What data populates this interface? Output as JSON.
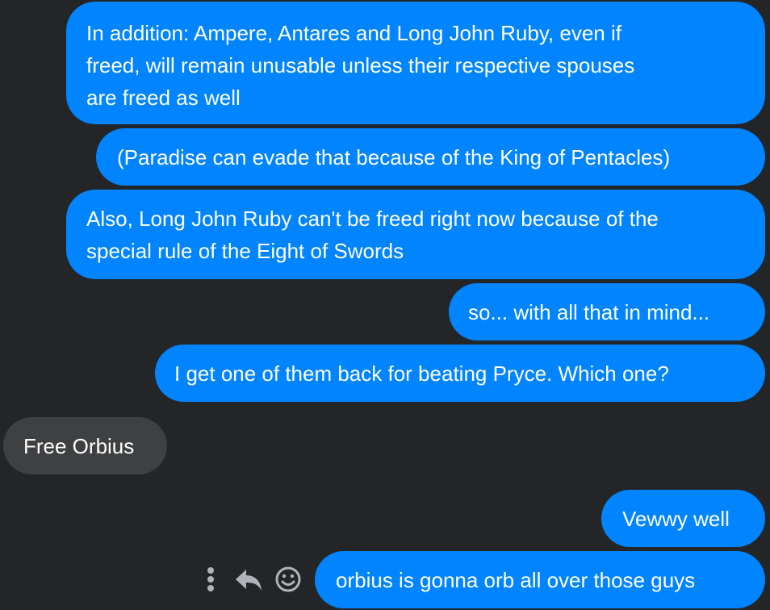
{
  "conversation": {
    "messages": [
      {
        "sender": "me",
        "text": "In addition: Ampere, Antares and Long John Ruby, even if\nfreed, will remain unusable unless their respective spouses\nare freed as well"
      },
      {
        "sender": "me",
        "text": "(Paradise can evade that because of the King of Pentacles)"
      },
      {
        "sender": "me",
        "text": "Also, Long John Ruby can't be freed right now because of the\nspecial rule of the Eight of Swords"
      },
      {
        "sender": "me",
        "text": "so... with all that in mind..."
      },
      {
        "sender": "me",
        "text": "I get one of them back for beating Pryce.  Which one?"
      },
      {
        "sender": "them",
        "text": "Free Orbius"
      },
      {
        "sender": "me",
        "text": "Vewwy well"
      },
      {
        "sender": "me",
        "text": "orbius is gonna orb all over those guys"
      }
    ]
  },
  "message_actions": {
    "icons": [
      "more-vertical-icon",
      "reply-icon",
      "emoji-icon"
    ]
  },
  "colors": {
    "background": "#242526",
    "sent_bubble": "#0084ff",
    "received_bubble": "#3e4042",
    "text": "#ffffff",
    "icon": "#b0b3b8"
  }
}
